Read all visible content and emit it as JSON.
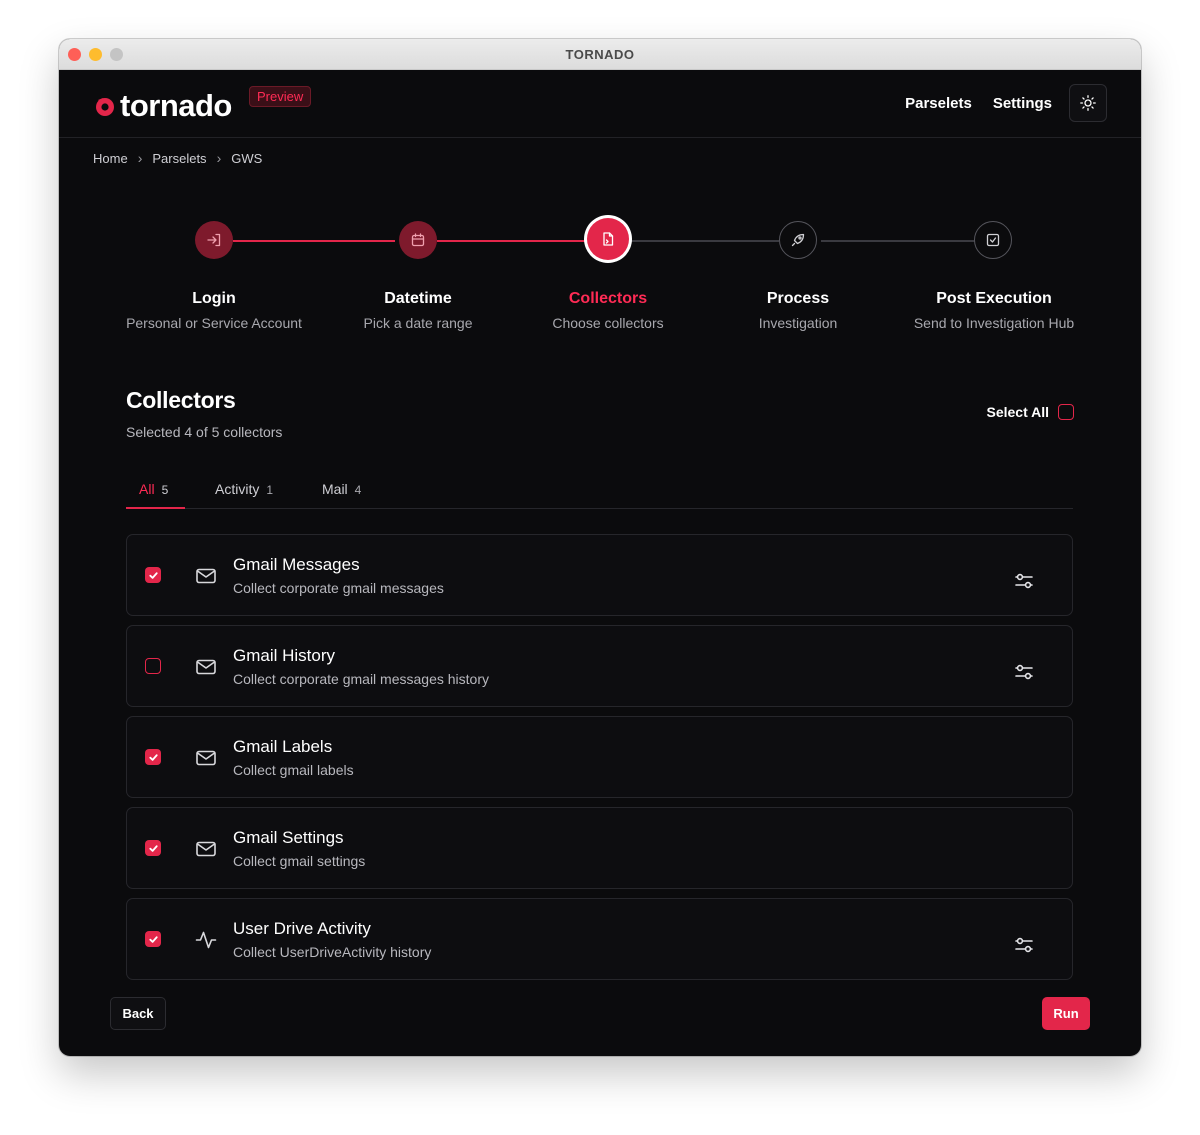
{
  "window": {
    "title": "TORNADO"
  },
  "header": {
    "logo_text": "tornado",
    "badge": "Preview",
    "nav": [
      {
        "label": "Parselets"
      },
      {
        "label": "Settings"
      }
    ],
    "theme_icon": "sun-icon"
  },
  "breadcrumb": [
    "Home",
    "Parselets",
    "GWS"
  ],
  "steps": [
    {
      "title": "Login",
      "subtitle": "Personal or Service Account",
      "state": "done",
      "icon": "login-icon"
    },
    {
      "title": "Datetime",
      "subtitle": "Pick a date range",
      "state": "done",
      "icon": "calendar-icon"
    },
    {
      "title": "Collectors",
      "subtitle": "Choose collectors",
      "state": "current",
      "icon": "document-icon"
    },
    {
      "title": "Process",
      "subtitle": "Investigation",
      "state": "todo",
      "icon": "rocket-icon"
    },
    {
      "title": "Post Execution",
      "subtitle": "Send to Investigation Hub",
      "state": "todo",
      "icon": "check-square-icon"
    }
  ],
  "collectors_section": {
    "title": "Collectors",
    "summary": "Selected 4 of 5 collectors",
    "select_all_label": "Select All",
    "select_all_checked": false
  },
  "tabs": [
    {
      "label": "All",
      "count": "5",
      "active": true
    },
    {
      "label": "Activity",
      "count": "1",
      "active": false
    },
    {
      "label": "Mail",
      "count": "4",
      "active": false
    }
  ],
  "collectors": [
    {
      "name": "Gmail Messages",
      "description": "Collect corporate gmail messages",
      "checked": true,
      "icon": "mail-icon",
      "configurable": true
    },
    {
      "name": "Gmail History",
      "description": "Collect corporate gmail messages history",
      "checked": false,
      "icon": "mail-icon",
      "configurable": true
    },
    {
      "name": "Gmail Labels",
      "description": "Collect gmail labels",
      "checked": true,
      "icon": "mail-icon",
      "configurable": false
    },
    {
      "name": "Gmail Settings",
      "description": "Collect gmail settings",
      "checked": true,
      "icon": "mail-icon",
      "configurable": false
    },
    {
      "name": "User Drive Activity",
      "description": "Collect UserDriveActivity history",
      "checked": true,
      "icon": "activity-icon",
      "configurable": true
    }
  ],
  "footer": {
    "back_label": "Back",
    "run_label": "Run"
  },
  "colors": {
    "accent": "#e3264a",
    "background": "#0b0b0d",
    "card_border": "#26262b"
  }
}
